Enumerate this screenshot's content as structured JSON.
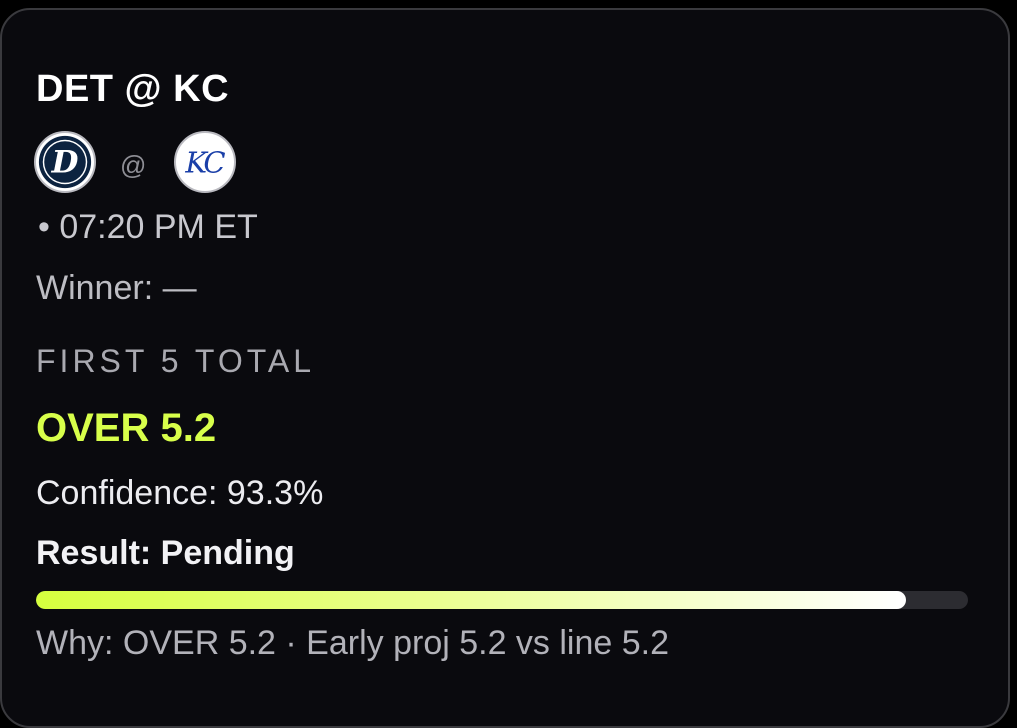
{
  "card": {
    "title": "DET @ KC",
    "away_team_logo": "detroit-tigers-logo",
    "home_team_logo": "kansas-city-royals-logo",
    "at_separator": "@",
    "time": "• 07:20 PM ET",
    "winner": "Winner: —",
    "market": "FIRST 5 TOTAL",
    "pick": "OVER 5.2",
    "confidence": "Confidence: 93.3%",
    "confidence_value": 93.3,
    "result": "Result: Pending",
    "why": "Why: OVER 5.2 · Early proj 5.2 vs line 5.2"
  },
  "colors": {
    "background": "#0a0a0e",
    "pick_accent": "#d8ff4a",
    "bar_track": "#2c2c31"
  }
}
